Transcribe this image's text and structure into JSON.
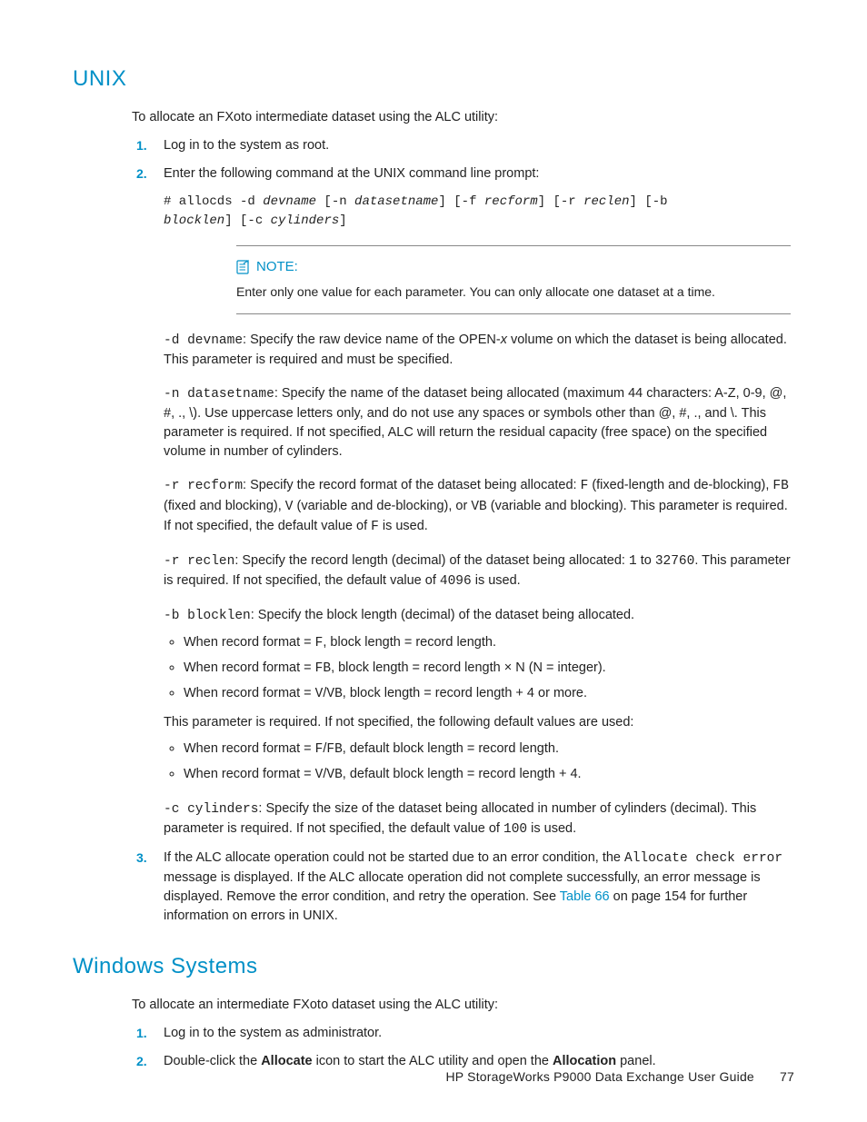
{
  "sections": {
    "unix": {
      "title": "UNIX",
      "intro": "To allocate an FXoto intermediate dataset using the ALC utility:",
      "steps": {
        "s1": "Log in to the system as root.",
        "s2": "Enter the following command at the UNIX command line prompt:",
        "s3_a": "If the ALC allocate operation could not be started due to an error condition, the ",
        "s3_code": "Allocate check error",
        "s3_b": " message is displayed. If the ALC allocate operation did not complete successfully, an error message is displayed. Remove the error condition, and retry the operation. See ",
        "s3_link": "Table 66",
        "s3_c": " on page 154 for further information on errors in UNIX."
      },
      "command": {
        "line1_a": "# allocds -d ",
        "line1_b": "devname",
        "line1_c": " [-n ",
        "line1_d": "datasetname",
        "line1_e": "] [-f ",
        "line1_f": "recform",
        "line1_g": "] [-r ",
        "line1_h": "reclen",
        "line1_i": "] [-b",
        "line2_a": "blocklen",
        "line2_b": "] [-c ",
        "line2_c": "cylinders",
        "line2_d": "]"
      },
      "note": {
        "heading": "NOTE:",
        "body": "Enter only one value for each parameter. You can only allocate one dataset at a time."
      },
      "params": {
        "d": {
          "flag": "-d devname",
          "desc_a": ": Specify the raw device name of the OPEN-",
          "desc_x": "x",
          "desc_b": " volume on which the dataset is being allocated. This parameter is required and must be specified."
        },
        "n": {
          "flag": "-n datasetname",
          "desc": ": Specify the name of the dataset being allocated (maximum 44 characters: A-Z, 0-9, @, #, ., \\). Use uppercase letters only, and do not use any spaces or symbols other than @, #, ., and \\. This parameter is required. If not specified, ALC will return the residual capacity (free space) on the specified volume in number of cylinders."
        },
        "rform": {
          "flag": "-r recform",
          "a": ": Specify the record format of the dataset being allocated: ",
          "f": "F",
          "b": " (fixed-length and de-blocking), ",
          "fb": "FB",
          "c": " (fixed and blocking), ",
          "v": "V",
          "d": " (variable and de-blocking), or ",
          "vb": "VB",
          "e": " (variable and blocking). This parameter is required. If not specified, the default value of ",
          "f2": "F",
          "g": " is used."
        },
        "rlen": {
          "flag": "-r reclen",
          "a": ": Specify the record length (decimal) of the dataset being allocated: ",
          "one": "1",
          "to": " to ",
          "max": "32760",
          "b": ". This parameter is required. If not specified, the default value of ",
          "def": "4096",
          "c": " is used."
        },
        "b": {
          "flag": "-b blocklen",
          "desc": ": Specify the block length (decimal) of the dataset being allocated.",
          "bul1_a": "When record format = ",
          "bul1_b": "F",
          "bul1_c": ", block length = record length.",
          "bul2_a": "When record format = ",
          "bul2_b": "FB",
          "bul2_c": ", block length = record length × N (N = integer).",
          "bul3_a": "When record format = ",
          "bul3_b": "V",
          "bul3_slash": "/",
          "bul3_b2": "VB",
          "bul3_c": ", block length = record length + 4 or more.",
          "after": "This parameter is required. If not specified, the following default values are used:",
          "bul4_a": "When record format = ",
          "bul4_b": "F",
          "bul4_slash": "/",
          "bul4_b2": "FB",
          "bul4_c": ", default block length = record length.",
          "bul5_a": "When record format = ",
          "bul5_b": "V",
          "bul5_slash": "/",
          "bul5_b2": "VB",
          "bul5_c": ", default block length = record length + 4."
        },
        "c": {
          "flag": "-c cylinders",
          "a": ": Specify the size of the dataset being allocated in number of cylinders (decimal). This parameter is required. If not specified, the default value of ",
          "def": "100",
          "b": " is used."
        }
      }
    },
    "windows": {
      "title": "Windows Systems",
      "intro": "To allocate an intermediate FXoto dataset using the ALC utility:",
      "steps": {
        "s1": "Log in to the system as administrator.",
        "s2_a": "Double-click the ",
        "s2_b": "Allocate",
        "s2_c": " icon to start the ALC utility and open the ",
        "s2_d": "Allocation",
        "s2_e": " panel."
      }
    }
  },
  "footer": {
    "title": "HP StorageWorks P9000 Data Exchange User Guide",
    "page": "77"
  }
}
